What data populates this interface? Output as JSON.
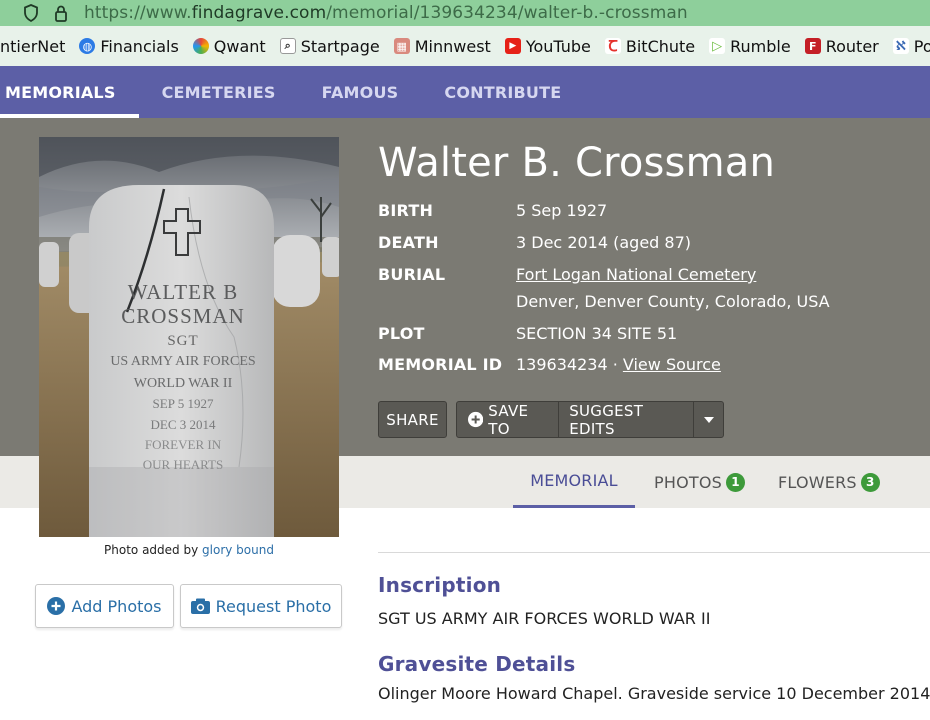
{
  "browser": {
    "url_prefix": "https://www.",
    "url_domain": "findagrave.com",
    "url_path": "/memorial/139634234/walter-b.-crossman",
    "bookmarks": [
      {
        "label": "ntierNet",
        "icon": "none"
      },
      {
        "label": "Financials",
        "icon": "globe-icon"
      },
      {
        "label": "Qwant",
        "icon": "qwant-icon"
      },
      {
        "label": "Startpage",
        "icon": "startpage-icon"
      },
      {
        "label": "Minnwest",
        "icon": "minnwest-icon"
      },
      {
        "label": "YouTube",
        "icon": "youtube-icon"
      },
      {
        "label": "BitChute",
        "icon": "bitchute-icon"
      },
      {
        "label": "Rumble",
        "icon": "rumble-icon"
      },
      {
        "label": "Router",
        "icon": "router-icon"
      },
      {
        "label": "Poal",
        "icon": "poal-icon"
      }
    ]
  },
  "nav": {
    "items": [
      "MEMORIALS",
      "CEMETERIES",
      "FAMOUS",
      "CONTRIBUTE"
    ],
    "active": "MEMORIALS"
  },
  "memorial": {
    "name": "Walter B. Crossman",
    "birth_label": "BIRTH",
    "birth_value": "5 Sep 1927",
    "death_label": "DEATH",
    "death_value": "3 Dec 2014 (aged 87)",
    "burial_label": "BURIAL",
    "burial_cemetery": "Fort Logan National Cemetery",
    "burial_location": "Denver, Denver County, Colorado, USA",
    "plot_label": "PLOT",
    "plot_value": "SECTION 34 SITE 51",
    "id_label": "MEMORIAL ID",
    "id_value": "139634234 ·",
    "view_source": "View Source"
  },
  "photo": {
    "caption_prefix": "Photo added by",
    "caption_user": "glory bound",
    "headstone_lines": [
      "WALTER B",
      "CROSSMAN",
      "SGT",
      "US ARMY AIR FORCES",
      "WORLD WAR II",
      "SEP 5 1927",
      "DEC 3 2014",
      "FOREVER IN",
      "OUR HEARTS"
    ]
  },
  "actions": {
    "share": "SHARE",
    "save_to": "SAVE TO",
    "suggest_edits": "SUGGEST EDITS",
    "add_photos": "Add Photos",
    "request_photo": "Request Photo"
  },
  "tabs": {
    "memorial": "MEMORIAL",
    "photos": "PHOTOS",
    "photos_count": "1",
    "flowers": "FLOWERS",
    "flowers_count": "3"
  },
  "content": {
    "inscription_heading": "Inscription",
    "inscription_text": "SGT US ARMY AIR FORCES WORLD WAR II",
    "gravesite_heading": "Gravesite Details",
    "gravesite_text": "Olinger Moore Howard Chapel. Graveside service 10 December 2014."
  },
  "colors": {
    "nav_bg": "#5c5fa6",
    "hero_bg": "#7b7a73",
    "badge_green": "#3d9a3a",
    "heading_purple": "#4f5096",
    "link_blue": "#2a6fa7"
  }
}
